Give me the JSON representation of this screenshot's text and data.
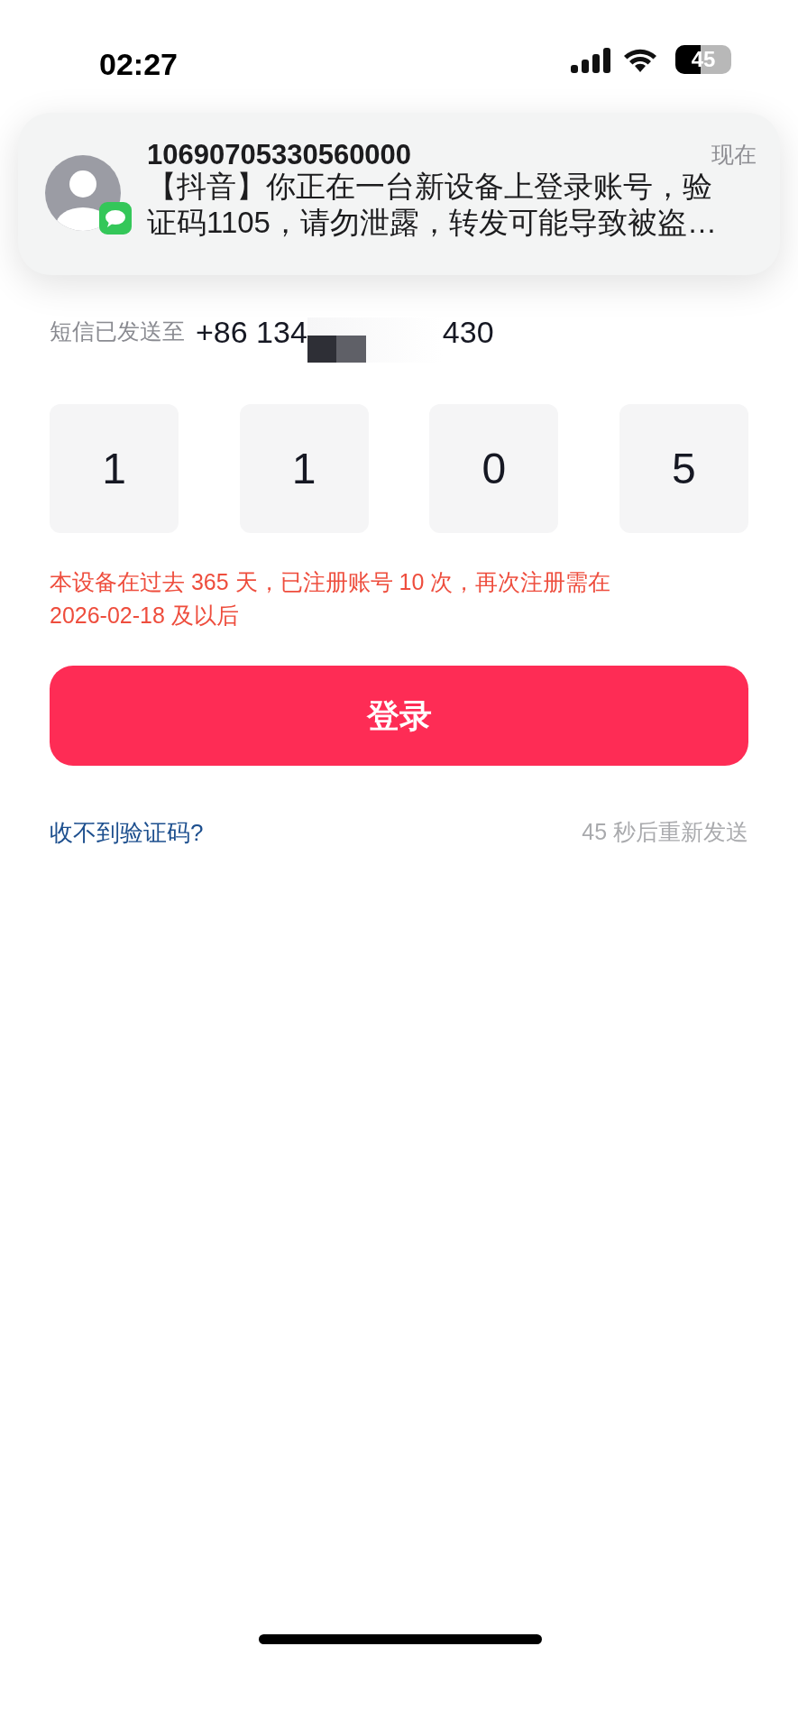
{
  "status_bar": {
    "time": "02:27",
    "battery": "45"
  },
  "notification": {
    "sender": "10690705330560000",
    "time": "现在",
    "body": "【抖音】你正在一台新设备上登录账号，验证码1105，请勿泄露，转发可能导致被盗…"
  },
  "page": {
    "sent_label": "短信已发送至",
    "phone_start": "+86 134",
    "phone_end": "430",
    "code_digits": [
      "1",
      "1",
      "0",
      "5"
    ],
    "warning": "本设备在过去 365 天，已注册账号 10 次，再次注册需在 2026-02-18 及以后",
    "login_button": "登录",
    "help_link": "收不到验证码?",
    "resend": "45 秒后重新发送"
  }
}
